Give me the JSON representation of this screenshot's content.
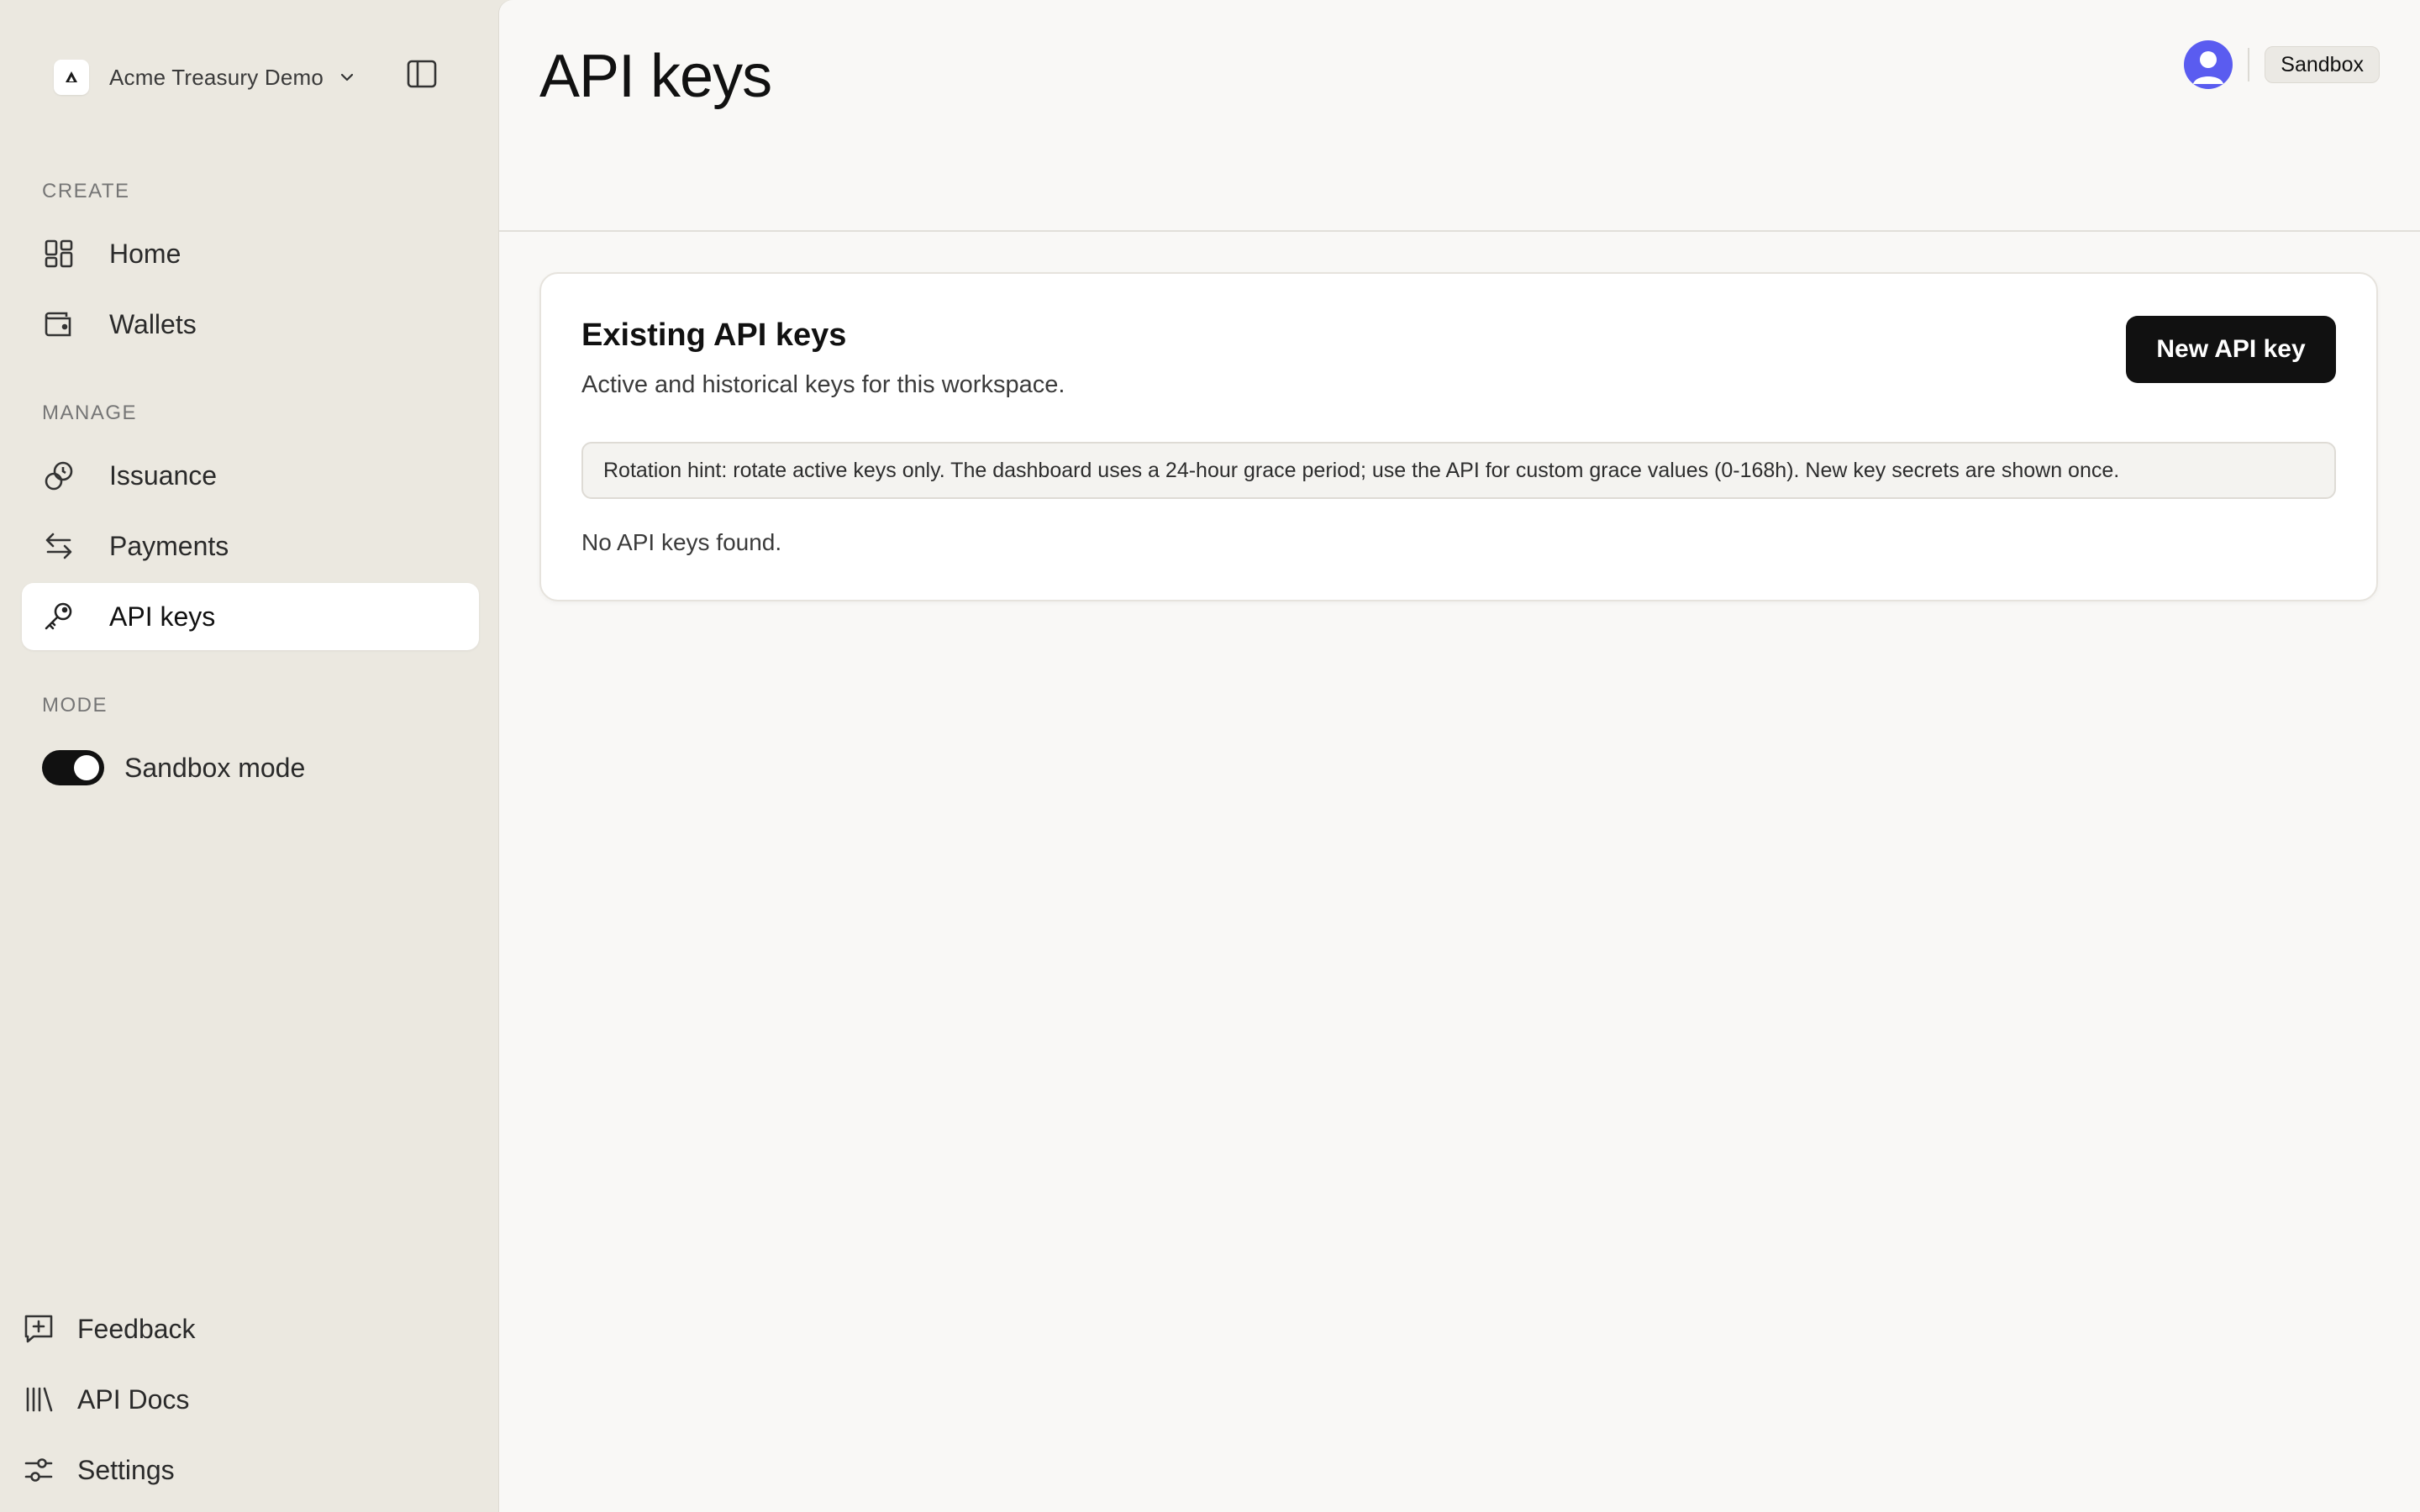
{
  "workspace": {
    "name": "Acme Treasury Demo"
  },
  "sidebar": {
    "sections": {
      "create": "CREATE",
      "manage": "MANAGE",
      "mode": "MODE"
    },
    "create_items": [
      {
        "label": "Home",
        "icon": "grid-icon"
      },
      {
        "label": "Wallets",
        "icon": "wallet-icon"
      }
    ],
    "manage_items": [
      {
        "label": "Issuance",
        "icon": "coins-icon"
      },
      {
        "label": "Payments",
        "icon": "arrows-swap-icon"
      },
      {
        "label": "API keys",
        "icon": "key-icon",
        "active": true
      }
    ],
    "mode_toggle": {
      "label": "Sandbox mode",
      "on": true
    },
    "footer_items": [
      {
        "label": "Feedback",
        "icon": "feedback-icon"
      },
      {
        "label": "API Docs",
        "icon": "library-icon"
      },
      {
        "label": "Settings",
        "icon": "sliders-icon"
      }
    ]
  },
  "header": {
    "title": "API keys",
    "environment_badge": "Sandbox"
  },
  "card": {
    "title": "Existing API keys",
    "subtitle": "Active and historical keys for this workspace.",
    "new_button": "New API key",
    "hint": "Rotation hint: rotate active keys only. The dashboard uses a 24-hour grace period; use the API for custom grace values (0-168h). New key secrets are shown once.",
    "empty_state": "No API keys found."
  },
  "colors": {
    "sidebar_bg": "#ebe8e0",
    "main_bg": "#f9f8f6",
    "primary_button": "#111111",
    "avatar": "#5a5cf0"
  }
}
